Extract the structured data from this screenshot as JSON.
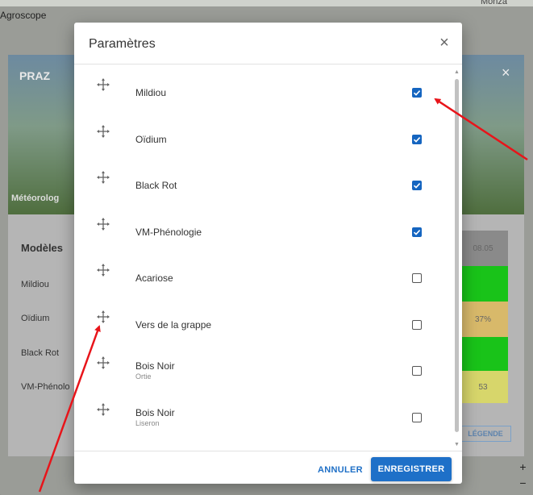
{
  "background": {
    "app_name": "Agroscope",
    "map_label": "Monza",
    "panel_title": "PRAZ",
    "photo_caption": "Météorolog",
    "table_header": "Modèles",
    "row_labels": [
      "Mildiou",
      "Oïdium",
      "Black Rot",
      "VM-Phénolo"
    ],
    "date_cell": "08.05",
    "oidium_cell": "37%",
    "pheno_cell": "53",
    "legend_button": "LÉGENDE",
    "zoom_in": "+",
    "zoom_out": "−",
    "cell_colors": [
      "#8a8a8a",
      "#19c319",
      "#d8b96a",
      "#19c319",
      "#d7d66b"
    ]
  },
  "dialog": {
    "title": "Paramètres",
    "close_glyph": "×",
    "items": [
      {
        "label": "Mildiou",
        "sub": "",
        "checked": true
      },
      {
        "label": "Oïdium",
        "sub": "",
        "checked": true
      },
      {
        "label": "Black Rot",
        "sub": "",
        "checked": true
      },
      {
        "label": "VM-Phénologie",
        "sub": "",
        "checked": true
      },
      {
        "label": "Acariose",
        "sub": "",
        "checked": false
      },
      {
        "label": "Vers de la grappe",
        "sub": "",
        "checked": false
      },
      {
        "label": "Bois Noir",
        "sub": "Ortie",
        "checked": false
      },
      {
        "label": "Bois Noir",
        "sub": "Liseron",
        "checked": false
      }
    ],
    "cancel_label": "ANNULER",
    "save_label": "ENREGISTRER",
    "accent_color": "#1e70c8",
    "drag_icon": "drag-move-icon"
  }
}
